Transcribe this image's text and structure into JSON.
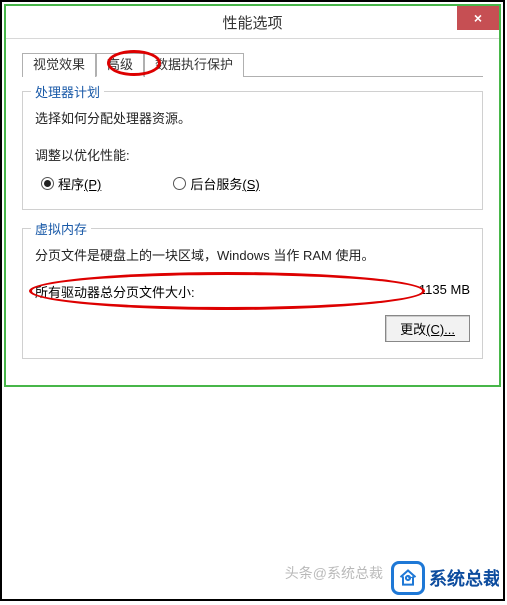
{
  "window": {
    "title": "性能选项",
    "close_icon": "×"
  },
  "tabs": {
    "visual": "视觉效果",
    "advanced": "高级",
    "dep": "数据执行保护"
  },
  "cpu_group": {
    "title": "处理器计划",
    "desc": "选择如何分配处理器资源。",
    "adjust_label": "调整以优化性能:",
    "radio_program": "程序",
    "radio_program_key": "(P)",
    "radio_service": "后台服务",
    "radio_service_key": "(S)"
  },
  "vm_group": {
    "title": "虚拟内存",
    "desc": "分页文件是硬盘上的一块区域，Windows 当作 RAM 使用。",
    "total_label": "所有驱动器总分页文件大小:",
    "total_value": "1135 MB",
    "change_label": "更改",
    "change_key": "(C)..."
  },
  "watermark": {
    "line": "头条@系统总裁",
    "brand": "系统总裁"
  }
}
